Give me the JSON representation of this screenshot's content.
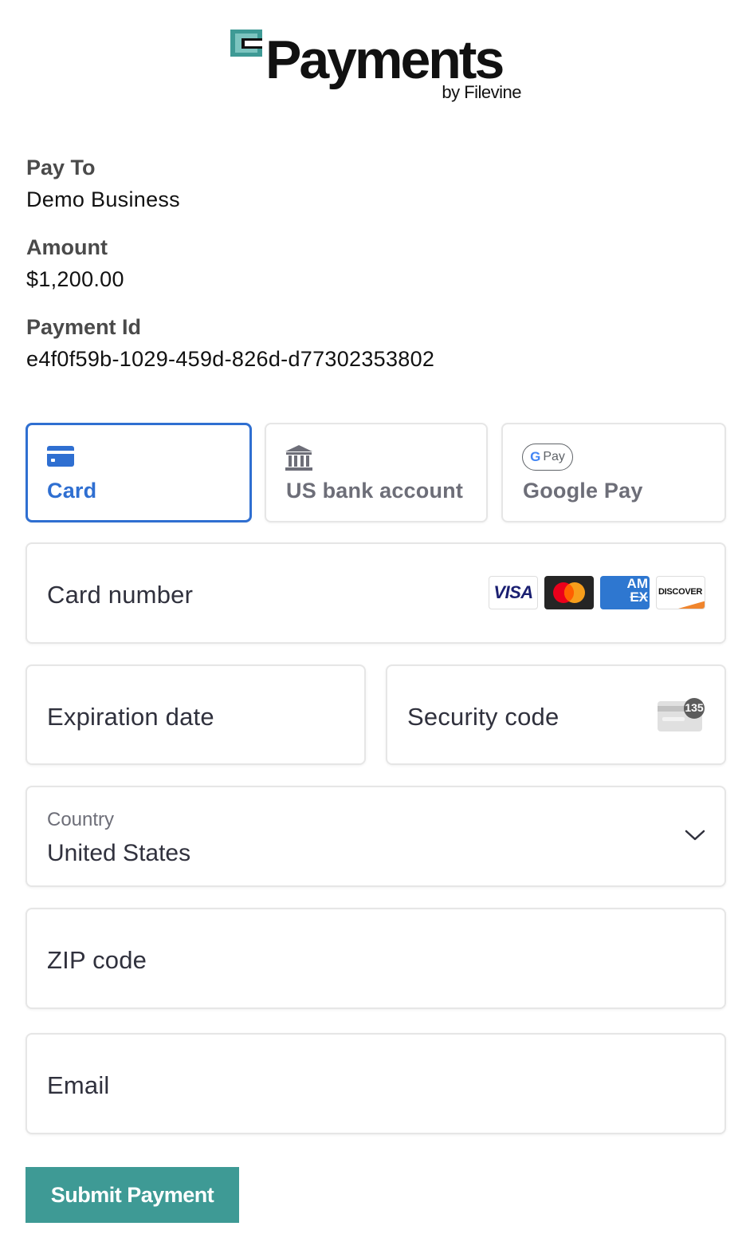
{
  "brand": {
    "wordmark": "Payments",
    "sub": "by Filevine",
    "accent_color": "#3e9a95"
  },
  "info": [
    {
      "label": "Pay To",
      "value": "Demo Business"
    },
    {
      "label": "Amount",
      "value": "$1,200.00"
    },
    {
      "label": "Payment Id",
      "value": "e4f0f59b-1029-459d-826d-d77302353802"
    }
  ],
  "tabs": [
    {
      "label": "Card",
      "icon": "credit-card-icon",
      "active": true
    },
    {
      "label": "US bank account",
      "icon": "bank-icon",
      "active": false
    },
    {
      "label": "Google Pay",
      "icon": "google-pay-icon",
      "badge": "Pay",
      "active": false
    }
  ],
  "fields": {
    "card_number": "Card number",
    "expiration": "Expiration date",
    "security": "Security code",
    "security_badge": "135",
    "country_label": "Country",
    "country_value": "United States",
    "zip": "ZIP code",
    "email": "Email"
  },
  "card_brands": {
    "visa": "VISA",
    "amex_top": "AM",
    "amex_bottom": "EX",
    "discover": "DISCOVER"
  },
  "submit_label": "Submit Payment",
  "colors": {
    "active_tab": "#2f6fd1",
    "submit": "#3e9a95",
    "text_muted": "#6d6e78"
  }
}
